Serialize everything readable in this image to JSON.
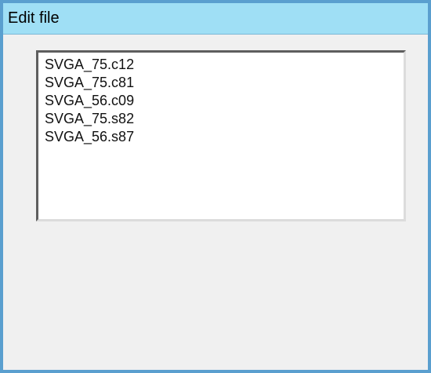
{
  "window": {
    "title": "Edit file"
  },
  "file_list": {
    "items": [
      "SVGA_75.c12",
      "SVGA_75.c81",
      "SVGA_56.c09",
      "SVGA_75.s82",
      "SVGA_56.s87"
    ]
  },
  "colors": {
    "titlebar": "#9fdff5",
    "window_border": "#5a9fcf",
    "background": "#f0f0f0"
  }
}
